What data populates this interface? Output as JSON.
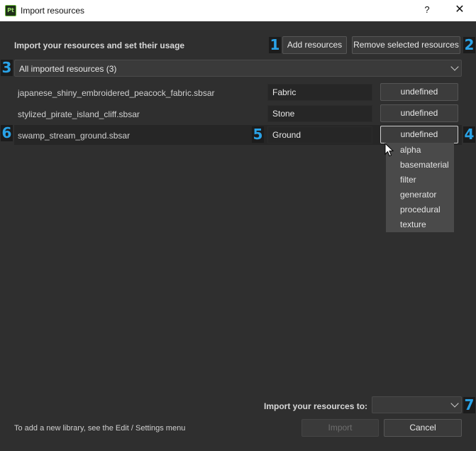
{
  "window": {
    "app_icon": "Pt",
    "title": "Import resources",
    "help_label": "?",
    "close_label": "✕"
  },
  "header": {
    "heading": "Import your resources and set their usage",
    "add_button": "Add resources",
    "remove_button": "Remove selected resources"
  },
  "filter": {
    "selected": "All imported resources (3)"
  },
  "resources": [
    {
      "filename": "japanese_shiny_embroidered_peacock_fabric.sbsar",
      "usage": "Fabric",
      "type": "undefined"
    },
    {
      "filename": "stylized_pirate_island_cliff.sbsar",
      "usage": "Stone",
      "type": "undefined"
    },
    {
      "filename": "swamp_stream_ground.sbsar",
      "usage": "Ground",
      "type": "undefined"
    }
  ],
  "type_menu": {
    "options": [
      "alpha",
      "basematerial",
      "filter",
      "generator",
      "procedural",
      "texture"
    ]
  },
  "badges": [
    "1",
    "2",
    "3",
    "4",
    "5",
    "6",
    "7"
  ],
  "footer": {
    "destination_label": "Import your resources to:",
    "destination_value": "",
    "hint": "To add a new library, see the Edit / Settings menu",
    "import_button": "Import",
    "cancel_button": "Cancel"
  },
  "colors": {
    "accent_badge": "#2aa3e8",
    "background": "#2f2f2f",
    "titlebar": "#ffffff"
  },
  "icons": {
    "chevron": "chevron-down-icon",
    "cursor": "mouse-pointer-icon",
    "close": "close-icon",
    "help": "help-icon"
  }
}
